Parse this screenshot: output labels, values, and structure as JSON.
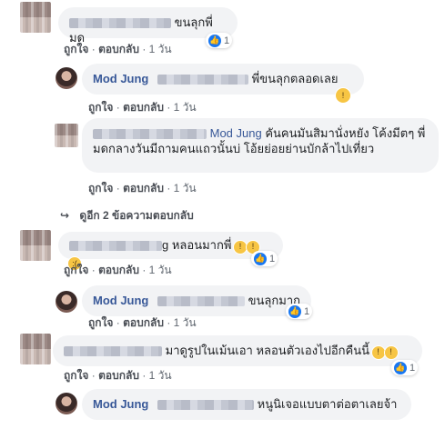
{
  "actions": {
    "like": "ถูกใจ",
    "reply": "ตอบกลับ",
    "sep": "·",
    "time": "1 วัน"
  },
  "comments": [
    {
      "text": "ขนลุกพี่มด",
      "reactions": "1"
    },
    {
      "name": "Mod Jung",
      "text": "พี่ขนลุกตลอดเลย",
      "reactions": ""
    },
    {
      "name": "Mod Jung",
      "text": "คันคนมันสิมานั่งหยัง โค้งมีตๆ พี่มดกลางวันมีถามคนแถวนั้นบ่ โอ้ยย่อยย่านบักล้าไปเที่ยว"
    },
    {
      "view_more": "ดูอีก 2 ข้อความตอบกลับ"
    },
    {
      "name_tail": "g",
      "text": "หลอนมากพี่",
      "reactions": "1"
    },
    {
      "name": "Mod Jung",
      "text": "ขนลุกมาก",
      "reactions": "1"
    },
    {
      "text": "มาดูรูปในเม้นเอา หลอนตัวเองไปอีกคืนนี้",
      "reactions": "1"
    },
    {
      "name": "Mod Jung",
      "text": "หนูนิเจอแบบตาต่อตาเลยจ้า"
    }
  ]
}
